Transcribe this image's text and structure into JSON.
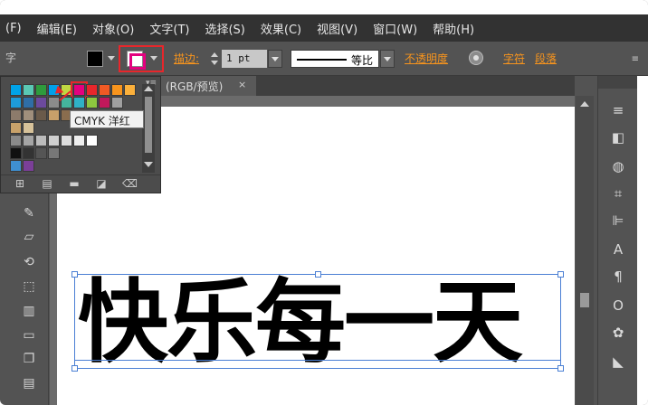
{
  "menu": {
    "items": [
      "(F)",
      "编辑(E)",
      "对象(O)",
      "文字(T)",
      "选择(S)",
      "效果(C)",
      "视图(V)",
      "窗口(W)",
      "帮助(H)"
    ]
  },
  "control_bar": {
    "left_label": "字",
    "stroke_label": "描边:",
    "stroke_weight": "1 pt",
    "profile_label": "等比",
    "opacity_label": "不透明度",
    "character_label": "字符",
    "paragraph_label": "段落",
    "menu_icon": "≡"
  },
  "document_tab": {
    "title": "(RGB/预览)",
    "close": "×"
  },
  "swatch_popup": {
    "tooltip": "CMYK 洋红",
    "selected_color": "#e4007f",
    "grip": "▾≡",
    "rows": [
      [
        "#00a3e8",
        "#5ac8b4",
        "#2e9b3c",
        "#00a0e9",
        "#bfd742",
        "#e4007f",
        "#e8262b",
        "#f15a24",
        "#f7941d",
        "#fbb03b"
      ],
      [
        "#1d9bd8",
        "#2f6ea6",
        "#6c4a9e",
        "#8b8b8b",
        "#44b59d",
        "#2fb2c6",
        "#8dc63f",
        "#c2185b",
        "#a0a0a0"
      ],
      [
        "#8c7b6b",
        "#a08f7c",
        "#6a5a4a",
        "#c8a06a",
        "#8a6d4e"
      ],
      [
        "#c9a26a",
        "#d7c29a"
      ],
      [
        "#8a8a8a",
        "#a5a5a5",
        "#bcbcbc",
        "#cfcfcf",
        "#dedede",
        "#eeeeee",
        "#ffffff"
      ],
      [
        "#111111",
        "#333333",
        "#555555",
        "#777777"
      ],
      [
        "#3f8fd0",
        "#7b3f98"
      ]
    ],
    "footer_icons": [
      "grid-icon",
      "library-icon",
      "folder-icon",
      "new-swatch-icon",
      "trash-icon"
    ]
  },
  "artboard": {
    "text": "快乐每一天"
  },
  "colors": {
    "highlight_red": "#e8262b",
    "accent_orange": "#f7941d",
    "selection_blue": "#4a7fd4"
  }
}
